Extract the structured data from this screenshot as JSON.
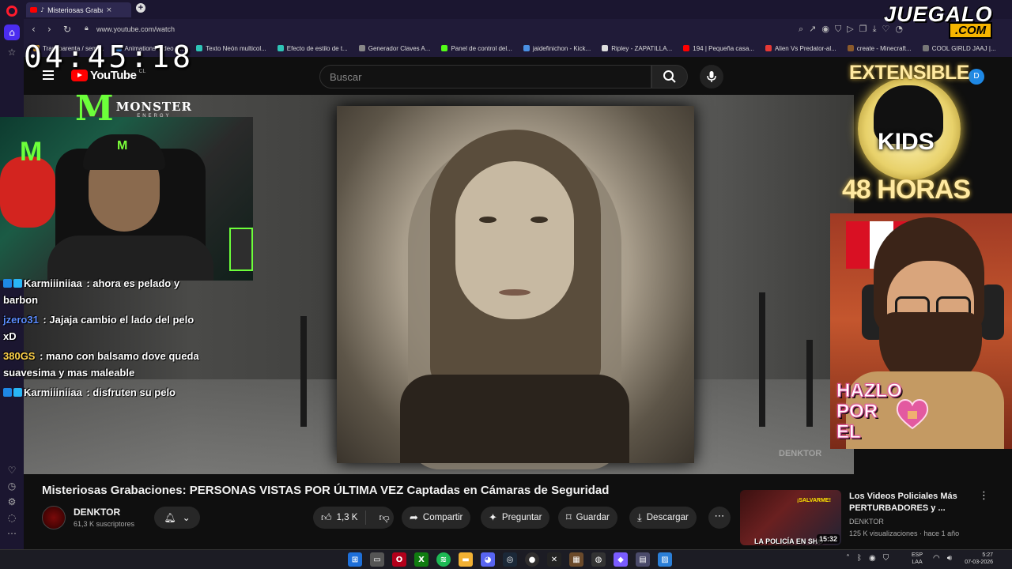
{
  "browser": {
    "tab_title": "Misteriosas Grabacion",
    "url": "www.youtube.com/watch",
    "bookmarks": [
      {
        "label": "Transparenta / semi...",
        "color": "#e0a030"
      },
      {
        "label": "Animations Video C...",
        "color": "#4a90e2"
      },
      {
        "label": "Texto Neón multicol...",
        "color": "#2ec4b6"
      },
      {
        "label": "Efecto de estilo de t...",
        "color": "#2ec4b6"
      },
      {
        "label": "Generador Claves A...",
        "color": "#888888"
      },
      {
        "label": "Panel de control del...",
        "color": "#53fc18"
      },
      {
        "label": "jaidefinichon - Kick...",
        "color": "#4a90e2"
      },
      {
        "label": "Ripley - ZAPATILLA...",
        "color": "#dddddd"
      },
      {
        "label": "194 | Pequeña casa...",
        "color": "#ff0000"
      },
      {
        "label": "Alien Vs Predator-al...",
        "color": "#e53935"
      },
      {
        "label": "create - Minecraft...",
        "color": "#8b5a2b"
      },
      {
        "label": "COOL GIRLD JAAJ |...",
        "color": "#777777"
      }
    ]
  },
  "overlay": {
    "clock": "04:45:18",
    "juegalo": "JUEGALO",
    "juegalo_com": ".COM",
    "monster_word": "MONSTER",
    "monster_sub": "ENERGY",
    "ext_title": "EXTENSIBLE",
    "ext_kids": "KIDS",
    "ext_hours": "48 HORAS",
    "hazlo_lines": [
      "HAZLO",
      "POR",
      "EL"
    ],
    "chat": [
      {
        "user": "Karmiiiniiaa",
        "text": "ahora es pelado y barbon",
        "color": "#ffffff"
      },
      {
        "user": "jzero31",
        "text": "Jajaja cambio el lado del pelo xD",
        "color": "#5c8dff"
      },
      {
        "user": "380GS",
        "text": "mano con balsamo dove queda suavesima y mas maleable",
        "color": "#ffd24a"
      },
      {
        "user": "Karmiiiniiaa",
        "text": "disfruten su pelo",
        "color": "#ffffff"
      }
    ]
  },
  "youtube": {
    "logo": "YouTube",
    "country": "CL",
    "search_placeholder": "Buscar",
    "avatar_letter": "D",
    "video_watermark": "DENKTOR",
    "title": "Misteriosas Grabaciones: PERSONAS VISTAS POR ÚLTIMA VEZ Captadas en Cámaras de Seguridad",
    "channel": "DENKTOR",
    "subscribers": "61,3 K suscriptores",
    "likes": "1,3 K",
    "actions": {
      "share": "Compartir",
      "ask": "Preguntar",
      "save": "Guardar",
      "download": "Descargar"
    },
    "recommended": {
      "title": "Los Videos Policiales Más PERTURBADORES y ...",
      "channel": "DENKTOR",
      "meta": "125 K visualizaciones · hace 1 año",
      "duration": "15:32",
      "thumb_text": "LA POLICÍA EN SHO",
      "thumb_top": "¡SALVARME!"
    }
  },
  "taskbar": {
    "lang_top": "ESP",
    "lang_bottom": "LAA",
    "time": "5:27",
    "date": "07-03-2026"
  },
  "colors": {
    "youtube_red": "#ff0000",
    "opera_active": "#4b2cf0",
    "monster_green": "#6cff3a"
  }
}
